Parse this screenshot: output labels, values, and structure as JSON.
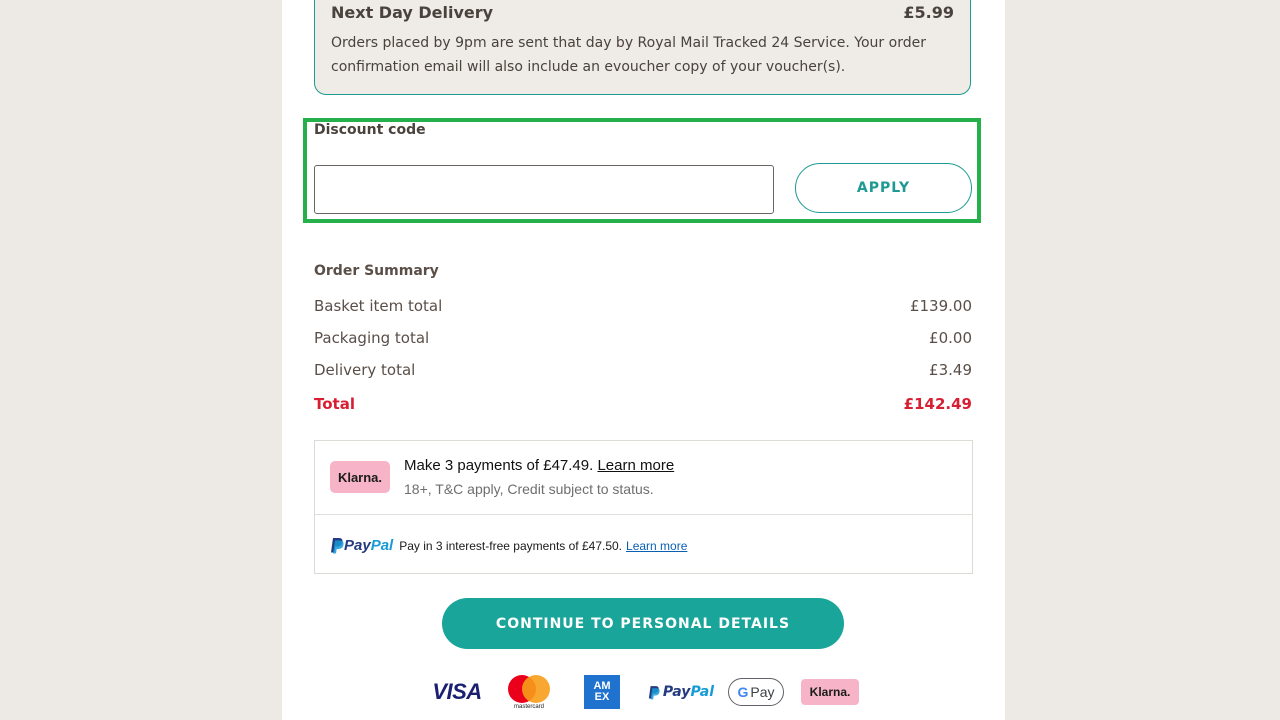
{
  "delivery": {
    "title": "Next Day Delivery",
    "price": "£5.99",
    "description": "Orders placed by 9pm are sent that day by Royal Mail Tracked 24 Service. Your order confirmation email will also include an evoucher copy of your voucher(s)."
  },
  "discount": {
    "label": "Discount code",
    "value": "",
    "apply_label": "APPLY"
  },
  "summary": {
    "title": "Order Summary",
    "rows": [
      {
        "label": "Basket item total",
        "value": "£139.00"
      },
      {
        "label": "Packaging total",
        "value": "£0.00"
      },
      {
        "label": "Delivery total",
        "value": "£3.49"
      }
    ],
    "total_label": "Total",
    "total_value": "£142.49"
  },
  "klarna": {
    "badge": "Klarna.",
    "text": "Make 3 payments of £47.49.",
    "link": "Learn more",
    "subtext": "18+, T&C apply, Credit subject to status."
  },
  "paypal": {
    "logo_pay": "Pay",
    "logo_pal": "Pal",
    "text": "Pay in 3 interest-free payments of £47.50.",
    "link": "Learn more"
  },
  "continue_label": "CONTINUE TO PERSONAL DETAILS",
  "payment_logos": {
    "visa": "VISA",
    "mastercard": "mastercard",
    "amex_top": "AM",
    "amex_bottom": "EX",
    "paypal_pay": "Pay",
    "paypal_pal": "Pal",
    "gpay_g": "G",
    "gpay_text": "Pay",
    "klarna": "Klarna."
  },
  "colors": {
    "accent": "#1aa59a",
    "total_red": "#d81e32",
    "highlight_green": "#25b04c"
  }
}
